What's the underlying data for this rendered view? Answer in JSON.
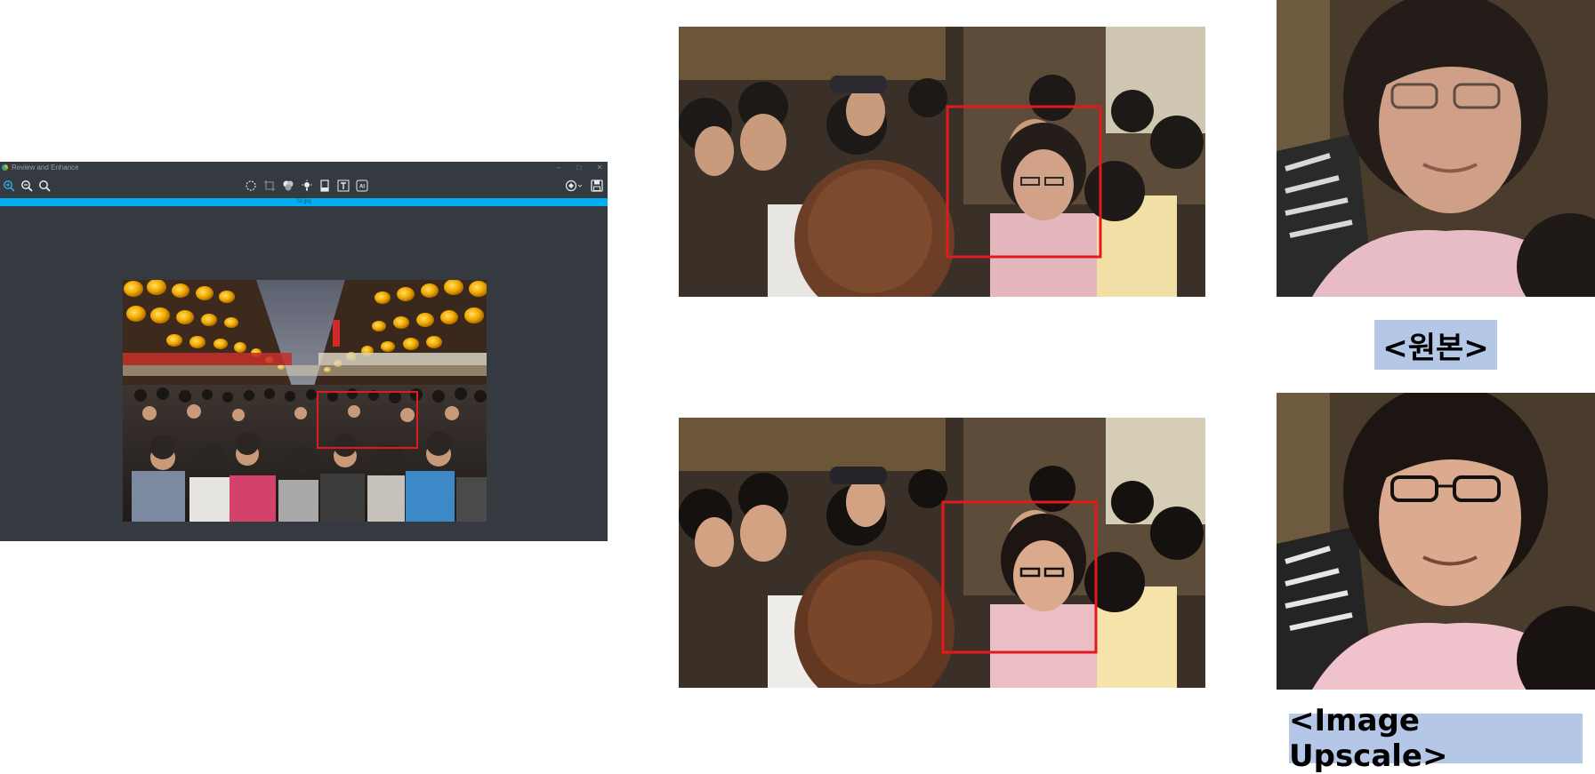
{
  "window": {
    "title": "Review and Enhance",
    "controls": {
      "minimize": "–",
      "maximize": "□",
      "close": "✕"
    }
  },
  "toolbar": {
    "left_tools": [
      "zoom-in-icon",
      "zoom-out-icon",
      "zoom-fit-icon"
    ],
    "center_tools": [
      "lasso-select-icon",
      "crop-icon",
      "color-balance-icon",
      "light-icon",
      "level-icon",
      "text-icon",
      "ai-icon"
    ],
    "right_tools": [
      "enhance-icon",
      "save-icon"
    ]
  },
  "file_bar": {
    "filename": "02.jpg"
  },
  "comparison": {
    "original_label": "<원본>",
    "upscale_label": "<Image Upscale>"
  },
  "colors": {
    "app_bg": "#343a40",
    "accent_bar": "#00b0f0",
    "selection_box": "#e3191e",
    "label_bg": "#b4c7e7",
    "zoom_tool_active": "#29a8e0"
  }
}
